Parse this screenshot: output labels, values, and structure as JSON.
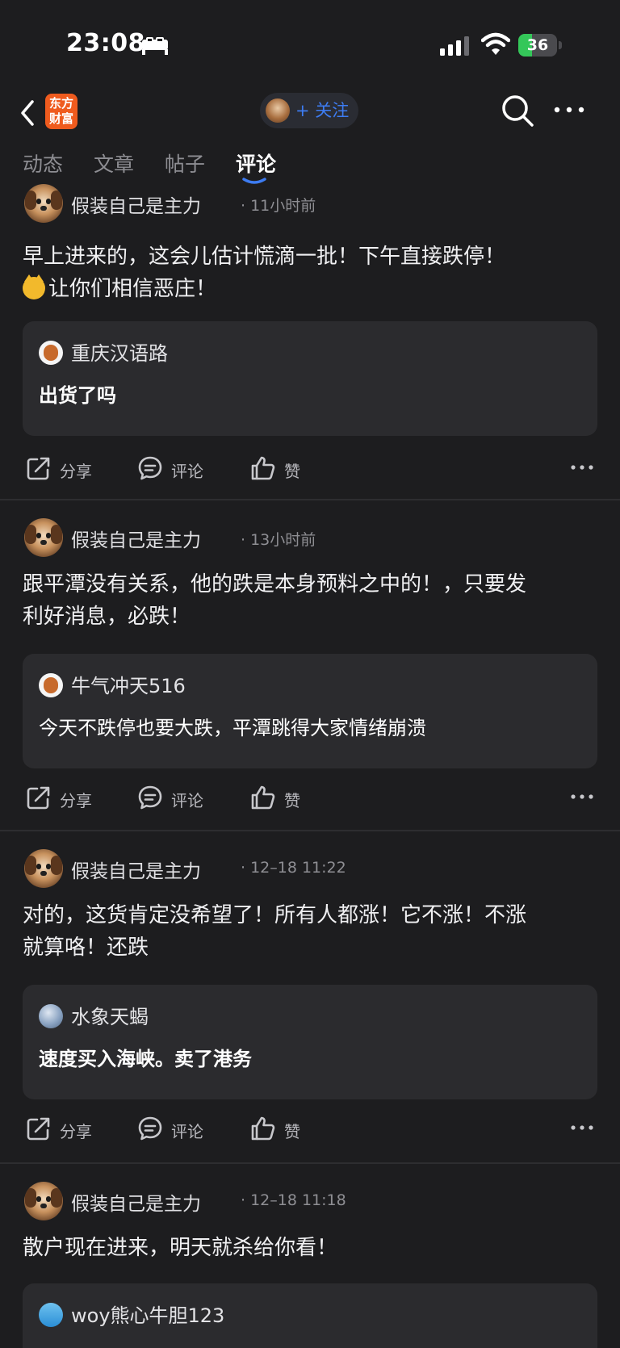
{
  "status_bar": {
    "time": "23:08",
    "battery": 36,
    "battery_label": "36"
  },
  "nav": {
    "logo_line1": "东方",
    "logo_line2": "财富",
    "follow_label": "+ 关注"
  },
  "tabs": [
    {
      "label": "动态",
      "active": false
    },
    {
      "label": "文章",
      "active": false
    },
    {
      "label": "帖子",
      "active": false
    },
    {
      "label": "评论",
      "active": true
    }
  ],
  "actions": {
    "share": "分享",
    "comment": "评论",
    "like": "赞"
  },
  "posts": [
    {
      "author": "假装自己是主力",
      "time": "· 11小时前",
      "content_line1": "早上进来的，这会儿估计慌滴一批！下午直接跌停！",
      "content_line2": "让你们相信恶庄！",
      "quote": {
        "name": "重庆汉语路",
        "text": "出货了吗"
      }
    },
    {
      "author": "假装自己是主力",
      "time": "· 13小时前",
      "content_line1": "跟平潭没有关系，他的跌是本身预料之中的！，只要发",
      "content_line2": "利好消息，必跌！",
      "quote": {
        "name": "牛气冲天516",
        "text": "今天不跌停也要大跌，平潭跳得大家情绪崩溃"
      }
    },
    {
      "author": "假装自己是主力",
      "time": "· 12–18 11:22",
      "content_line1": "对的，这货肯定没希望了！所有人都涨！它不涨！不涨",
      "content_line2": "就算咯！还跌",
      "quote": {
        "name": "水象天蝎",
        "text": "速度买入海峡。卖了港务"
      }
    },
    {
      "author": "假装自己是主力",
      "time": "· 12–18 11:18",
      "content_line1": "散户现在进来，明天就杀给你看！",
      "quote": {
        "name": "woy熊心牛胆123"
      }
    }
  ],
  "colors": {
    "background": "#1d1d1f",
    "accent_blue": "#3d7cf2",
    "brand_orange": "#ef5b1e",
    "battery_green": "#34c759",
    "quote_bg": "#2b2b2e"
  },
  "icons": [
    "bed-icon",
    "cellular-signal-icon",
    "wifi-icon",
    "battery-icon",
    "back-chevron-icon",
    "search-icon",
    "more-icon",
    "share-icon",
    "comment-icon",
    "like-icon"
  ]
}
